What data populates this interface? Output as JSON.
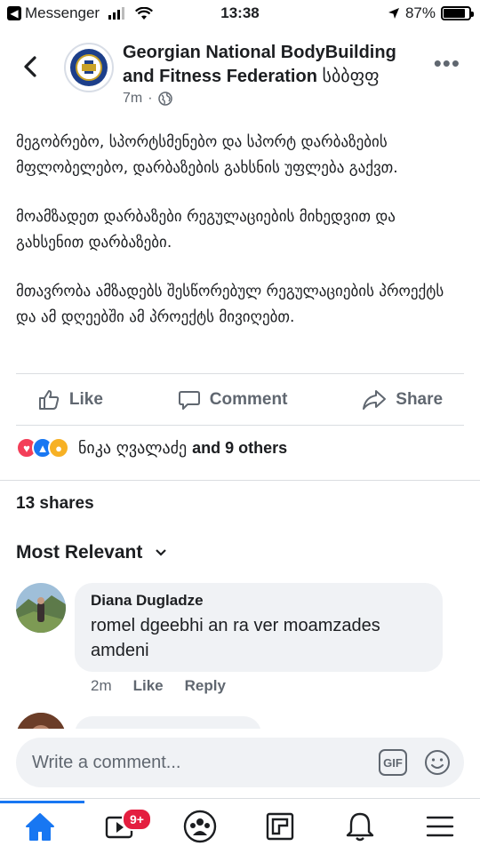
{
  "status_bar": {
    "back_app": "Messenger",
    "time": "13:38",
    "battery": "87%",
    "battery_level": 0.87
  },
  "post": {
    "page_name": "Georgian National BodyBuilding and Fitness Federation",
    "page_name_suffix": "სბბფფ",
    "time": "7m",
    "privacy_icon": "globe-icon",
    "paragraphs": [
      "მეგობრებო, სპორტსმენებო და სპორტ დარბაზების მფლობელებო, დარბაზების გახსნის უფლება გაქვთ.",
      "მოამზადეთ დარბაზები რეგულაციების მიხედვით და გახსენით დარბაზები.",
      "მთავრობა ამზადებს შესწორებულ რეგულაციების პროექტს და ამ დღეებში ამ პროექტს მივიღებთ."
    ]
  },
  "actions": {
    "like": "Like",
    "comment": "Comment",
    "share": "Share"
  },
  "reactions": {
    "names": "ნიკა ღვალაძე",
    "others": "and 9 others",
    "icons": [
      "love-reaction",
      "like-reaction",
      "wow-reaction"
    ]
  },
  "shares": "13 shares",
  "sort_label": "Most Relevant",
  "comment": {
    "author": "Diana Dugladze",
    "text": "romel dgeebhi an ra ver moamzades amdeni",
    "time": "2m",
    "like": "Like",
    "reply": "Reply"
  },
  "composer": {
    "placeholder": "Write a comment...",
    "gif": "GIF"
  },
  "nav": {
    "watch_badge": "9+"
  },
  "colors": {
    "accent": "#1877f2",
    "text": "#1c1e21",
    "secondary": "#606770",
    "bubble": "#f0f2f5",
    "badge": "#e41e3f"
  }
}
